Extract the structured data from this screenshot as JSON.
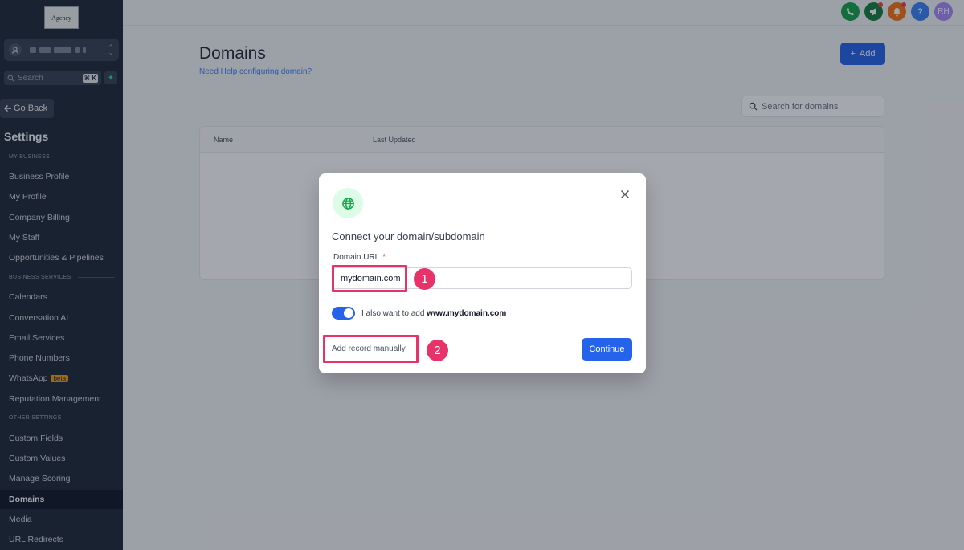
{
  "sidebar": {
    "logo_text": "Agency",
    "search_placeholder": "Search",
    "search_shortcut": "⌘ K",
    "back_label": "Go Back",
    "title": "Settings",
    "sections": [
      {
        "label": "MY BUSINESS"
      },
      {
        "label": "BUSINESS SERVICES"
      },
      {
        "label": "OTHER SETTINGS"
      }
    ],
    "items": [
      {
        "label": "Business Profile"
      },
      {
        "label": "My Profile"
      },
      {
        "label": "Company Billing"
      },
      {
        "label": "My Staff"
      },
      {
        "label": "Opportunities & Pipelines"
      },
      {
        "label": "Calendars"
      },
      {
        "label": "Conversation AI"
      },
      {
        "label": "Email Services"
      },
      {
        "label": "Phone Numbers"
      },
      {
        "label": "WhatsApp",
        "badge": "beta"
      },
      {
        "label": "Reputation Management"
      },
      {
        "label": "Custom Fields"
      },
      {
        "label": "Custom Values"
      },
      {
        "label": "Manage Scoring"
      },
      {
        "label": "Domains",
        "active": true
      },
      {
        "label": "Media"
      },
      {
        "label": "URL Redirects"
      }
    ]
  },
  "topbar": {
    "avatar_initials": "RH",
    "help_glyph": "?",
    "colors": {
      "phone": "#16a34a",
      "megaphone": "#15803d",
      "bell": "#f97316",
      "help": "#3b82f6",
      "avatar": "#a78bfa"
    }
  },
  "page": {
    "title": "Domains",
    "help_link": "Need Help configuring domain?",
    "add_label": "Add",
    "search_placeholder": "Search for domains",
    "table_headers": [
      "Name",
      "Last Updated"
    ]
  },
  "modal": {
    "title": "Connect your domain/subdomain",
    "field_label": "Domain URL",
    "required_mark": "*",
    "input_value": "mydomain.com",
    "toggle_prefix": "I also want to add ",
    "toggle_domain": "www.mydomain.com",
    "toggle_on": true,
    "manual_link": "Add record manually",
    "continue_label": "Continue"
  },
  "annotations": {
    "step1": "1",
    "step2": "2",
    "color": "#e8336a"
  }
}
